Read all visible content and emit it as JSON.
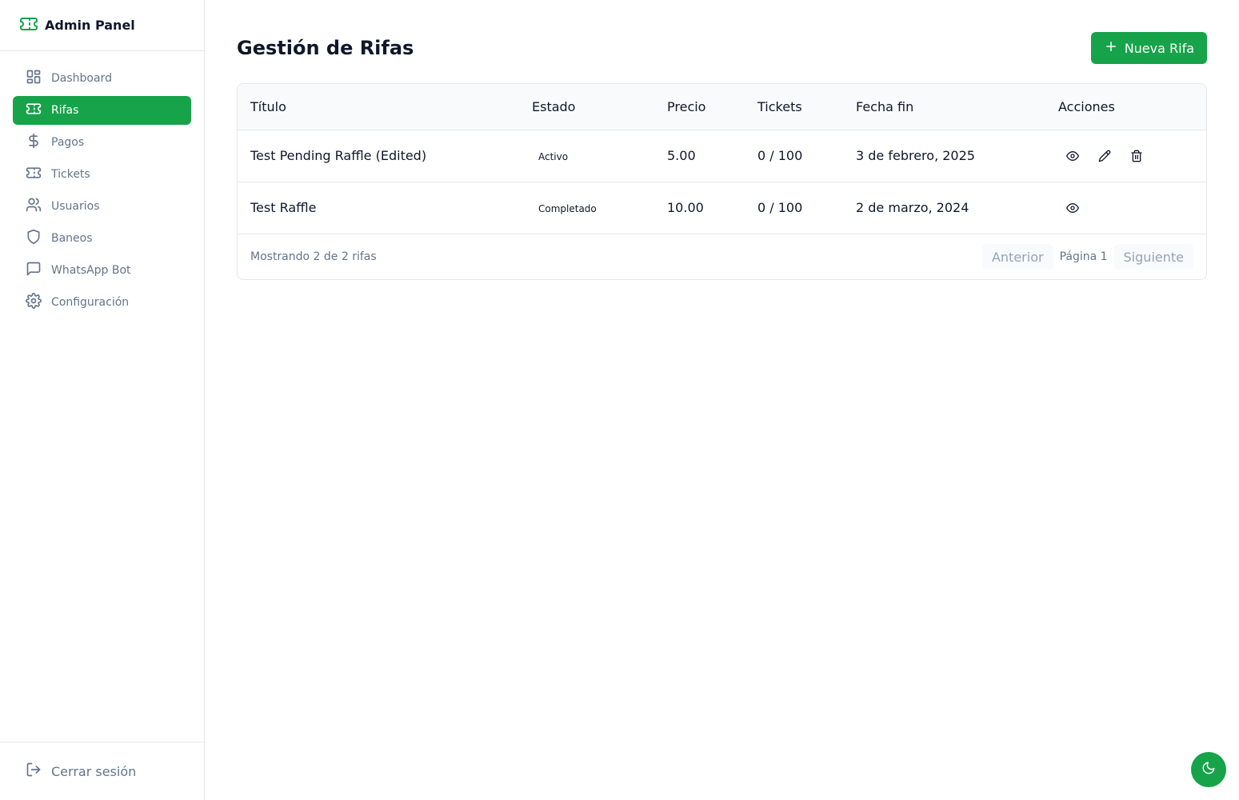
{
  "app": {
    "title": "Admin Panel",
    "logo_icon": "ticket-icon"
  },
  "colors": {
    "accent": "#16a34a",
    "muted_text": "#64748b",
    "border": "#e5e7eb"
  },
  "sidebar": {
    "items": [
      {
        "label": "Dashboard",
        "icon": "dashboard-icon",
        "active": false
      },
      {
        "label": "Rifas",
        "icon": "ticket-icon",
        "active": true
      },
      {
        "label": "Pagos",
        "icon": "dollar-icon",
        "active": false
      },
      {
        "label": "Tickets",
        "icon": "ticket-icon",
        "active": false
      },
      {
        "label": "Usuarios",
        "icon": "users-icon",
        "active": false
      },
      {
        "label": "Baneos",
        "icon": "shield-icon",
        "active": false
      },
      {
        "label": "WhatsApp Bot",
        "icon": "message-icon",
        "active": false
      },
      {
        "label": "Configuración",
        "icon": "gear-icon",
        "active": false
      }
    ],
    "logout_label": "Cerrar sesión"
  },
  "page": {
    "title": "Gestión de Rifas",
    "new_button_label": "Nueva Rifa"
  },
  "table": {
    "columns": [
      "Título",
      "Estado",
      "Precio",
      "Tickets",
      "Fecha fin",
      "Acciones"
    ],
    "rows": [
      {
        "title": "Test Pending Raffle (Edited)",
        "status": "Activo",
        "price": "5.00",
        "tickets": "0 / 100",
        "end_date": "3 de febrero, 2025",
        "actions": [
          "view",
          "edit",
          "delete"
        ]
      },
      {
        "title": "Test Raffle",
        "status": "Completado",
        "price": "10.00",
        "tickets": "0 / 100",
        "end_date": "2 de marzo, 2024",
        "actions": [
          "view"
        ]
      }
    ]
  },
  "footer": {
    "summary": "Mostrando 2 de 2 rifas",
    "prev_label": "Anterior",
    "page_label": "Página 1",
    "next_label": "Siguiente"
  },
  "theme_toggle_icon": "moon-icon"
}
